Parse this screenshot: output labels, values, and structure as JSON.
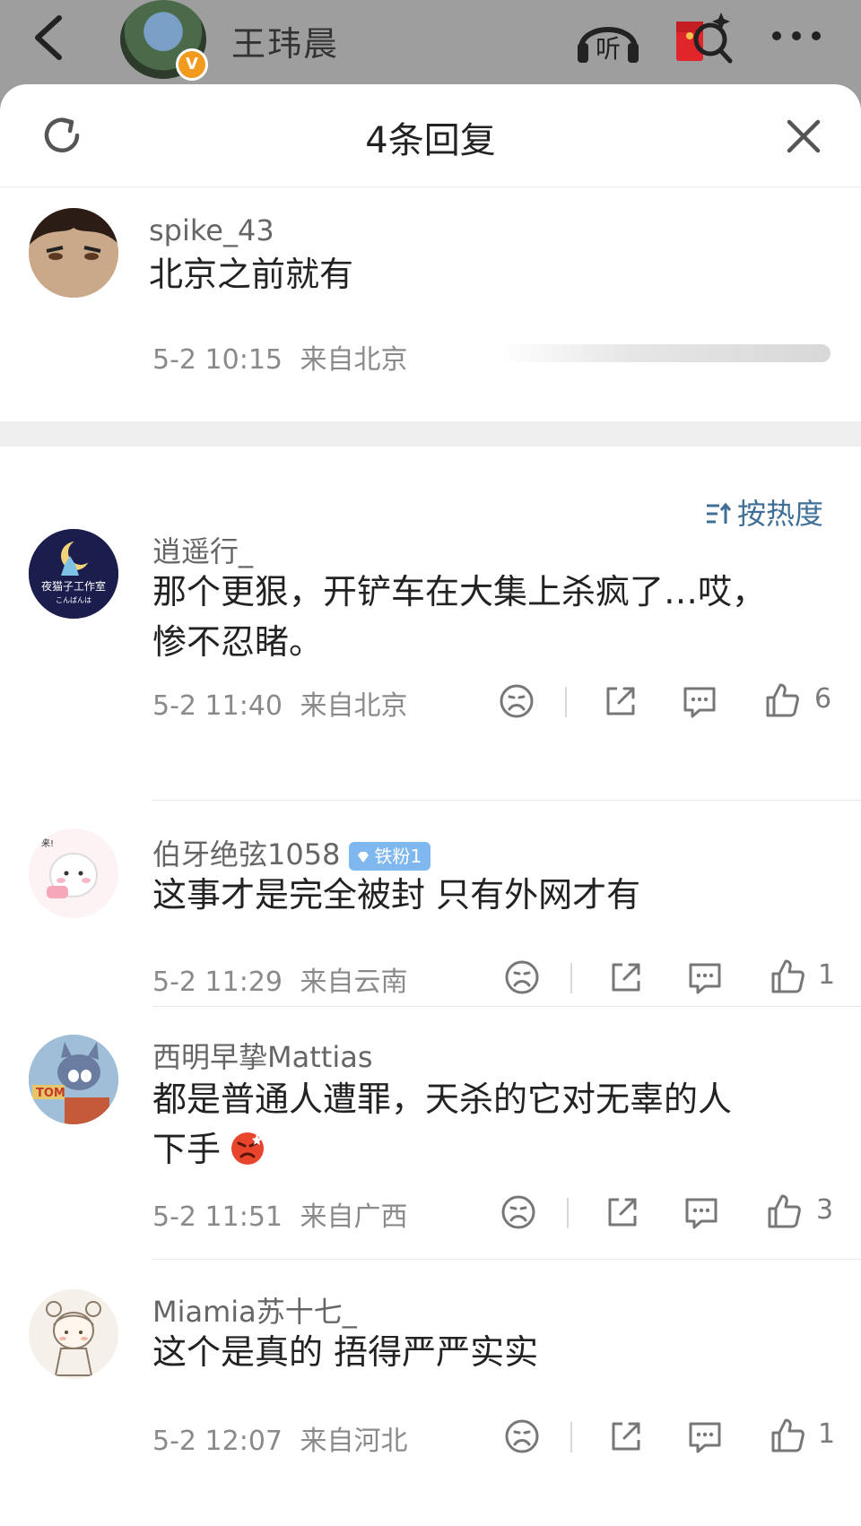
{
  "header": {
    "author_name": "王玮晨",
    "verified_badge": "V",
    "icons": [
      "back-icon",
      "listen-icon",
      "red-packet-search-icon",
      "more-icon"
    ],
    "listen_glyph": "听"
  },
  "sheet": {
    "title": "4条回复"
  },
  "root_comment": {
    "username": "spike_43",
    "text": "北京之前就有",
    "time": "5-2 10:15",
    "location": "来自北京"
  },
  "sort": {
    "label": "按热度"
  },
  "replies": [
    {
      "username": "逍遥行_",
      "badge": "",
      "text_line1": "那个更狠，开铲车在大集上杀疯了…哎，",
      "text_line2": "惨不忍睹。",
      "time": "5-2 11:40",
      "location": "来自北京",
      "likes": "6"
    },
    {
      "username": "伯牙绝弦1058",
      "badge": "铁粉1",
      "text_line1": "这事才是完全被封 只有外网才有",
      "text_line2": "",
      "time": "5-2 11:29",
      "location": "来自云南",
      "likes": "1"
    },
    {
      "username": "西明早挚Mattias",
      "badge": "",
      "text_line1": "都是普通人遭罪，天杀的它对无辜的人",
      "text_line2": "下手",
      "time": "5-2 11:51",
      "location": "来自广西",
      "likes": "3"
    },
    {
      "username": "Miamia苏十七_",
      "badge": "",
      "text_line1": "这个是真的 捂得严严实实",
      "text_line2": "",
      "time": "5-2 12:07",
      "location": "来自河北",
      "likes": "1"
    }
  ],
  "avatar_texts": {
    "reply0_studio": "夜猫子工作室",
    "reply0_sub": "こんばんは",
    "reply1_lai": "来!",
    "reply2_tom": "TOM"
  },
  "colors": {
    "accent": "#3f6f96",
    "badge": "#7fb8ef",
    "verified": "#f29a1d",
    "meta": "#8a8a8a"
  }
}
